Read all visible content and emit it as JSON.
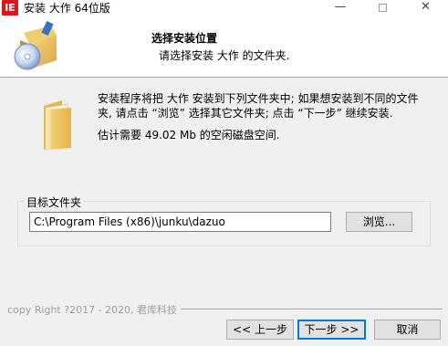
{
  "window": {
    "icon_text": "IE",
    "title": "安装 大作 64位版",
    "minimize_glyph": "—",
    "close_glyph": "✕"
  },
  "header": {
    "title": "选择安装位置",
    "subtitle": "请选择安装 大作 的文件夹."
  },
  "body": {
    "desc_line1": "安装程序将把 大作 安装到下列文件夹中; 如果想安装到不同的文件",
    "desc_line2": "夹, 请点击 “浏览” 选择其它文件夹; 点击 “下一步” 继续安装.",
    "space_required": "估计需要 49.02 Mb 的空闲磁盘空间."
  },
  "destination": {
    "group_label": "目标文件夹",
    "path_value": "C:\\Program Files (x86)\\junku\\dazuo",
    "browse_label": "浏览..."
  },
  "footer": {
    "copyright": "copy Right ?2017 - 2020, 君库科技",
    "back_label": "<< 上一步",
    "next_label": "下一步 >>",
    "cancel_label": "取消"
  },
  "colors": {
    "accent": "#0078d7",
    "app_icon": "#d9171d",
    "background": "#f0f0f0"
  }
}
